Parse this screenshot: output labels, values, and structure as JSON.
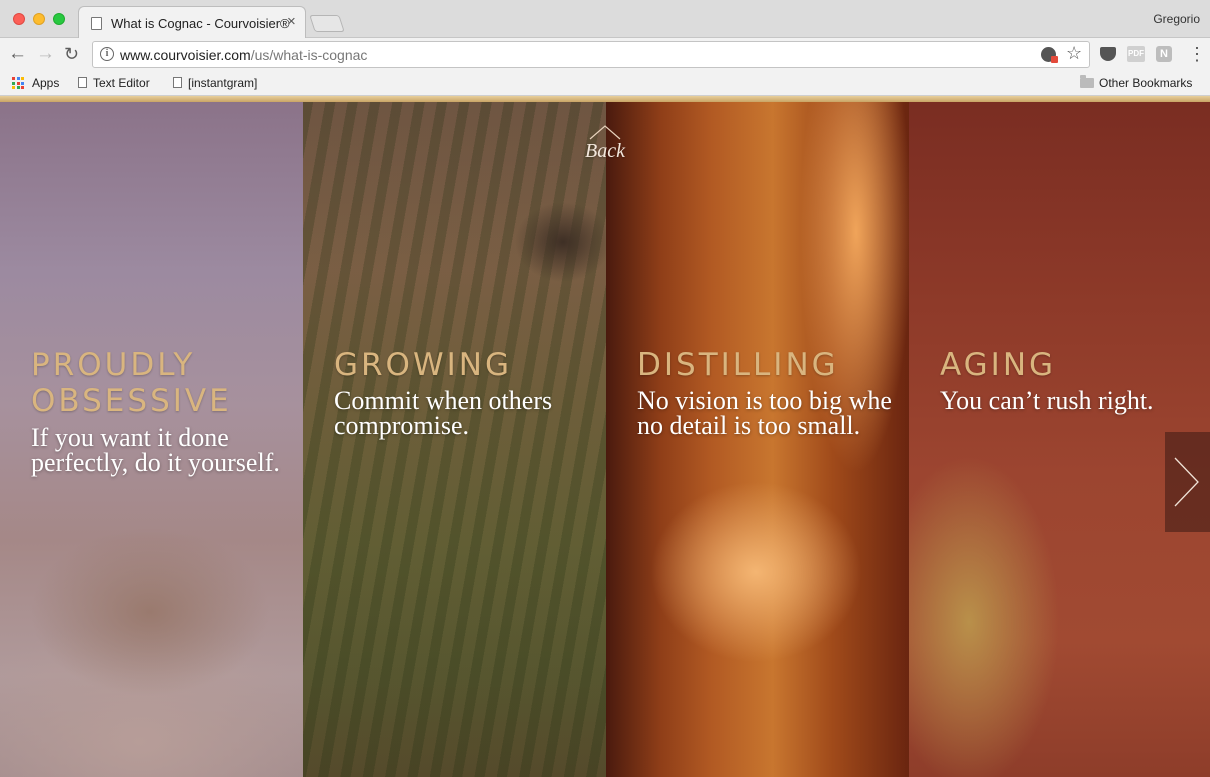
{
  "browser": {
    "tab_title": "What is Cognac - Courvoisier®",
    "tab_close": "×",
    "profile_name": "Gregorio",
    "url_host": "www.courvoisier.com",
    "url_path": "/us/what-is-cognac",
    "icons": [
      "back-arrow",
      "forward-arrow",
      "reload",
      "info",
      "extension-blocked",
      "bookmark-star",
      "pocket",
      "pdf",
      "extension-n",
      "menu-dots"
    ],
    "ext_pdf_label": "PDF",
    "ext_n_label": "N",
    "bookmarks": [
      {
        "label": "Apps",
        "icon": "apps-grid-icon"
      },
      {
        "label": "Text Editor",
        "icon": "page-icon"
      },
      {
        "label": "[instantgram]",
        "icon": "page-icon"
      }
    ],
    "other_bookmarks": "Other Bookmarks"
  },
  "page": {
    "back_label": "Back",
    "panels": [
      {
        "heading_line1": "PROUDLY",
        "heading_line2": "OBSESSIVE",
        "text_line1": "If you want it done",
        "text_line2": "perfectly, do it yourself."
      },
      {
        "heading_line1": "GROWING",
        "text_line1": "Commit when others",
        "text_line2": "compromise."
      },
      {
        "heading_line1": "DISTILLING",
        "text_line1": "No vision is too big whe",
        "text_line2": "no detail is too small."
      },
      {
        "heading_line1": "AGING",
        "text_line1": "You can’t rush right."
      }
    ],
    "colors": {
      "heading_gold": "#d9b57f",
      "accent_line": "#d4b27a"
    }
  }
}
